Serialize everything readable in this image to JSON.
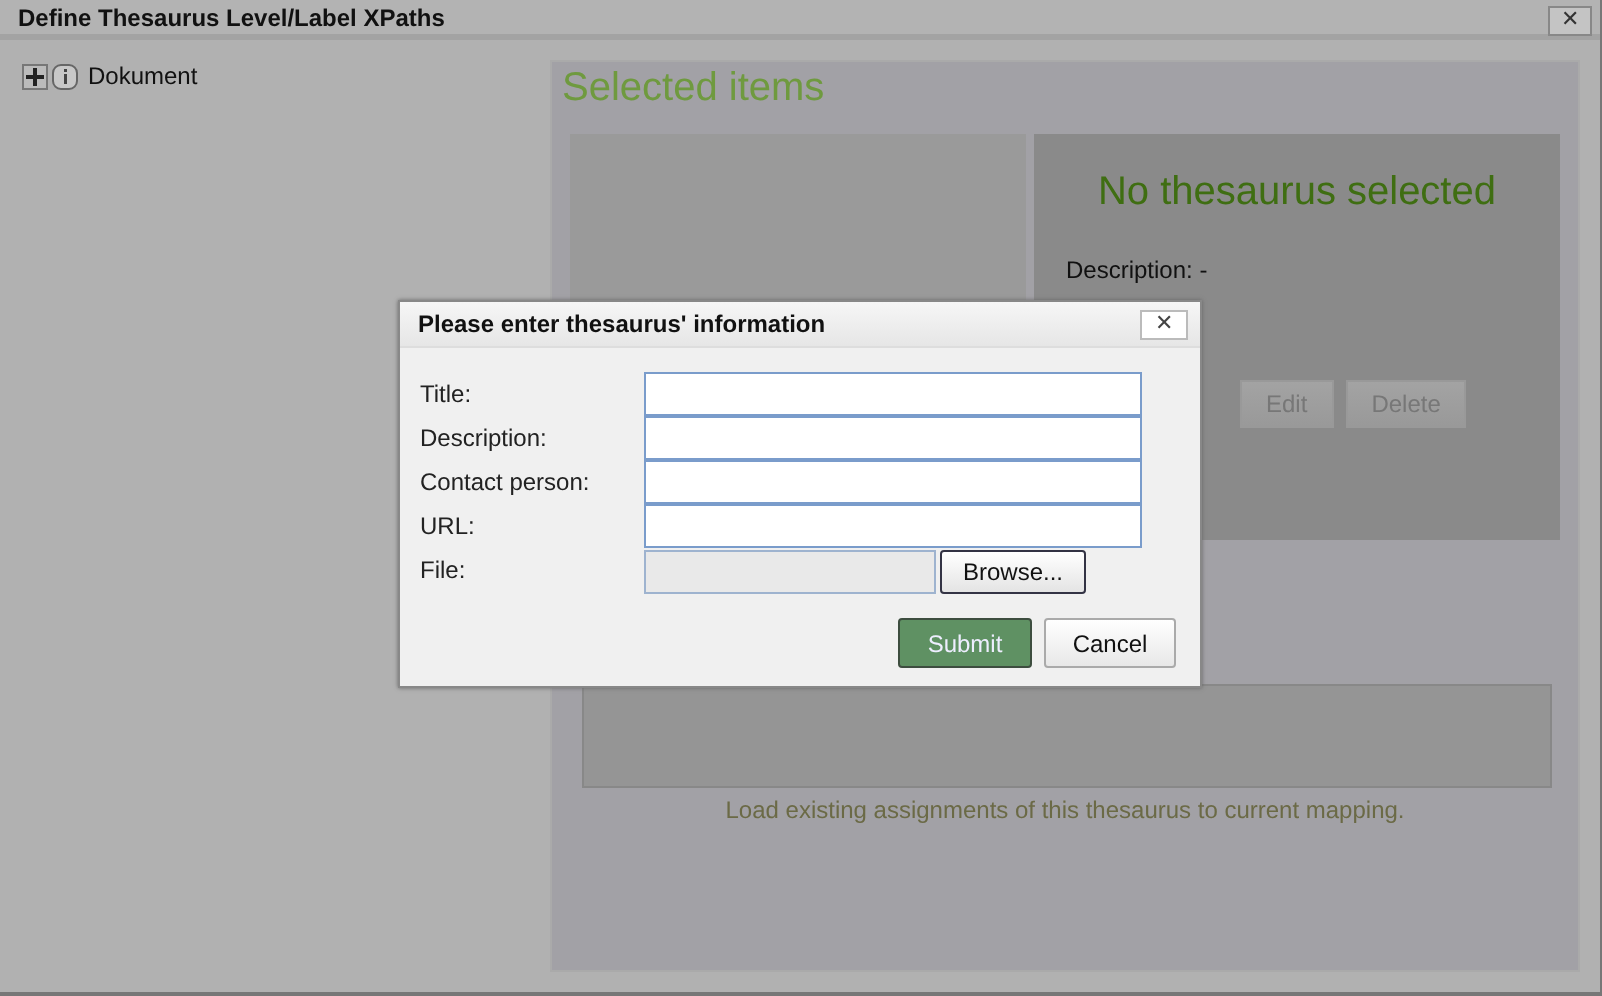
{
  "window": {
    "title": "Define Thesaurus Level/Label XPaths",
    "close": "✕"
  },
  "tree": [
    {
      "label": "Dokument",
      "expanded": false
    }
  ],
  "selected_panel": {
    "title": "Selected items",
    "thesaurus": {
      "heading": "No thesaurus selected",
      "description": "Description: -",
      "buttons": [
        {
          "label": "Edit",
          "disabled": true
        },
        {
          "label": "Delete",
          "disabled": true
        }
      ]
    },
    "load_hint": "Load existing assignments of this thesaurus to current mapping."
  },
  "dialog": {
    "title": "Please enter thesaurus' information",
    "close": "✕",
    "fields": [
      {
        "kind": "text",
        "label": "Title:"
      },
      {
        "kind": "text",
        "label": "Description:"
      },
      {
        "kind": "text",
        "label": "Contact person:"
      },
      {
        "kind": "text",
        "label": "URL:"
      },
      {
        "kind": "file",
        "label": "File:",
        "button": "Browse..."
      }
    ],
    "buttons": [
      {
        "label": "Submit",
        "primary": true
      },
      {
        "label": "Cancel",
        "primary": false
      }
    ]
  }
}
